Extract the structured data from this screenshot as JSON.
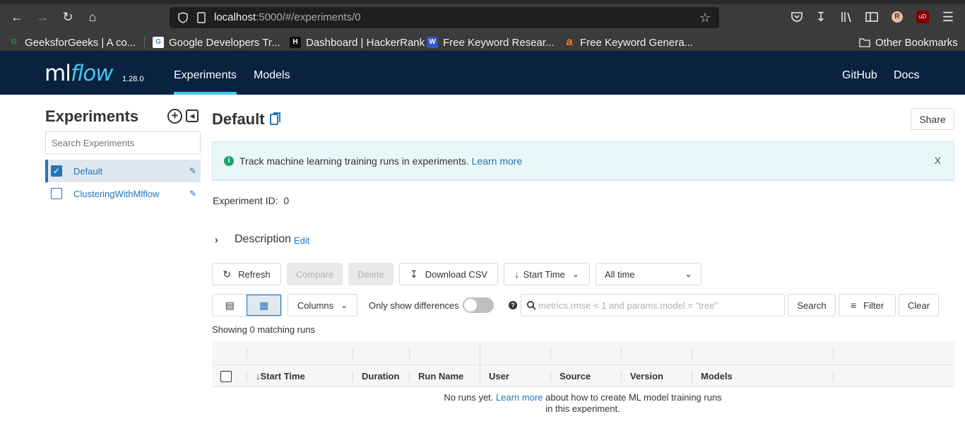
{
  "browser": {
    "url_host": "localhost",
    "url_path": ":5000/#/experiments/0",
    "avatar_letter": "R",
    "ublock_label": "uD",
    "bookmarks": [
      {
        "label": "GeeksforGeeks | A co...",
        "icon": "geeksforgeeks-icon",
        "fav": "G",
        "color": "#2f8d46"
      },
      {
        "label": "Google Developers Tr...",
        "icon": "google-developers-icon",
        "fav": "G",
        "color": "#4285f4"
      },
      {
        "label": "Dashboard | HackerRank",
        "icon": "hackerrank-icon",
        "fav": "H",
        "color": "#111111"
      },
      {
        "label": "Free Keyword Resear...",
        "icon": "wordtracker-icon",
        "fav": "W",
        "color": "#2f56c6"
      },
      {
        "label": "Free Keyword Genera...",
        "icon": "ahrefs-icon",
        "fav": "a",
        "color": "#f58220"
      }
    ],
    "other_bookmarks": "Other Bookmarks"
  },
  "header": {
    "logo_ml": "ml",
    "logo_flow": "flow",
    "version": "1.28.0",
    "nav": [
      "Experiments",
      "Models"
    ],
    "right_links": [
      "GitHub",
      "Docs"
    ],
    "accent": "#43c9ed",
    "bg": "#082240"
  },
  "sidebar": {
    "title": "Experiments",
    "search_placeholder": "Search Experiments",
    "experiments": [
      {
        "name": "Default",
        "selected": true
      },
      {
        "name": "ClusteringWithMlflow",
        "selected": false
      }
    ]
  },
  "main": {
    "title": "Default",
    "share_label": "Share",
    "banner_text": "Track machine learning training runs in experiments.",
    "banner_link": "Learn more",
    "banner_close": "X",
    "experiment_id_label": "Experiment ID:",
    "experiment_id": "0",
    "description_label": "Description",
    "description_edit": "Edit",
    "toolbar": {
      "refresh": "Refresh",
      "compare": "Compare",
      "delete": "Delete",
      "download_csv": "Download CSV",
      "sort": "Start Time",
      "time_range": "All time"
    },
    "columns_label": "Columns",
    "only_diff_label": "Only show differences",
    "search_placeholder": "metrics.rmse < 1 and params.model = \"tree\"",
    "search_label": "Search",
    "filter_label": "Filter",
    "clear_label": "Clear",
    "showing_text": "Showing 0 matching runs",
    "table_headers": [
      "Start Time",
      "Duration",
      "Run Name",
      "User",
      "Source",
      "Version",
      "Models"
    ],
    "empty_pre": "No runs yet.",
    "empty_link": "Learn more",
    "empty_post": "about how to create ML model training runs in this experiment."
  }
}
